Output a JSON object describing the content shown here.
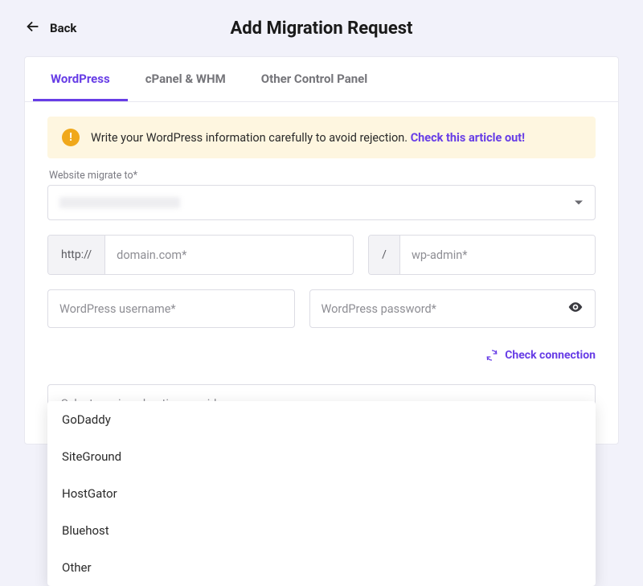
{
  "header": {
    "back_label": "Back",
    "title": "Add Migration Request"
  },
  "tabs": [
    {
      "label": "WordPress",
      "active": true
    },
    {
      "label": "cPanel & WHM",
      "active": false
    },
    {
      "label": "Other Control Panel",
      "active": false
    }
  ],
  "alert": {
    "text": "Write your WordPress information carefully to avoid rejection. ",
    "link_text": "Check this article out!"
  },
  "fields": {
    "migrate_to_label": "Website migrate to*",
    "http_prefix": "http://",
    "domain_placeholder": "domain.com*",
    "slash": "/",
    "wpadmin_placeholder": "wp-admin*",
    "username_placeholder": "WordPress username*",
    "password_placeholder": "WordPress password*"
  },
  "actions": {
    "check_connection": "Check connection"
  },
  "provider_select": {
    "placeholder": "Select previous hosting provider",
    "options": [
      "GoDaddy",
      "SiteGround",
      "HostGator",
      "Bluehost",
      "Other"
    ]
  }
}
